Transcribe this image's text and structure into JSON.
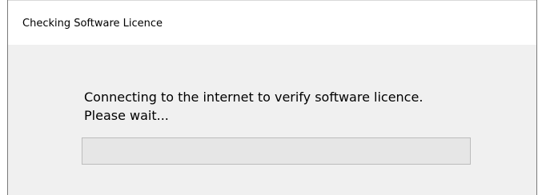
{
  "window": {
    "title": "Checking Software Licence"
  },
  "message": {
    "line1": "Connecting to the internet to verify software licence.",
    "line2": "Please wait..."
  },
  "progress": {
    "value_percent": 0
  }
}
